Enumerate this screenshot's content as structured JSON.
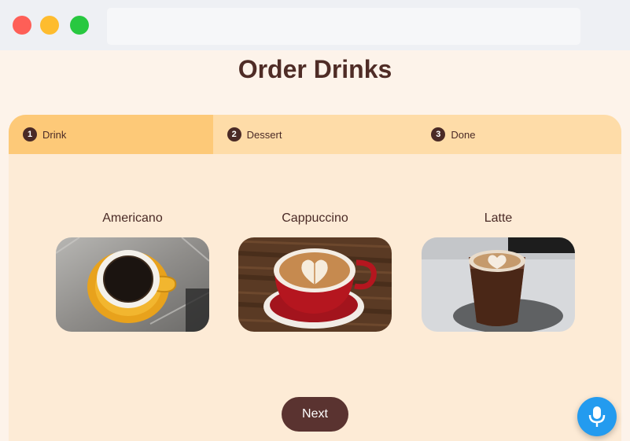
{
  "page": {
    "title": "Order Drinks"
  },
  "steps": [
    {
      "num": "1",
      "label": "Drink",
      "active": true
    },
    {
      "num": "2",
      "label": "Dessert",
      "active": false
    },
    {
      "num": "3",
      "label": "Done",
      "active": false
    }
  ],
  "drinks": [
    {
      "name": "Americano",
      "image": "americano-photo"
    },
    {
      "name": "Cappuccino",
      "image": "cappuccino-photo"
    },
    {
      "name": "Latte",
      "image": "latte-photo"
    }
  ],
  "actions": {
    "next_label": "Next"
  },
  "colors": {
    "accent": "#5a3330",
    "stepper_active": "#fdc978",
    "stepper_bg": "#fedca8",
    "card_bg": "#fdebd6",
    "mic": "#239bef"
  }
}
